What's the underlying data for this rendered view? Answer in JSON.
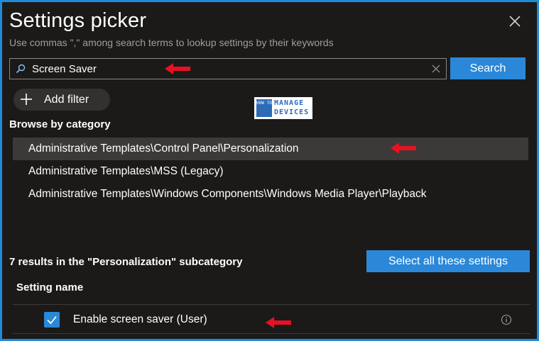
{
  "dialog": {
    "title": "Settings picker",
    "subtitle": "Use commas \",\" among search terms to lookup settings by their keywords"
  },
  "search": {
    "value": "Screen Saver",
    "button_label": "Search"
  },
  "add_filter": {
    "label": "Add filter"
  },
  "watermark": {
    "line1": "MANAGE",
    "line2": "DEVICES",
    "small": "HOW TO"
  },
  "browse": {
    "heading": "Browse by category",
    "categories": [
      {
        "label": "Administrative Templates\\Control Panel\\Personalization",
        "selected": true
      },
      {
        "label": "Administrative Templates\\MSS (Legacy)",
        "selected": false
      },
      {
        "label": "Administrative Templates\\Windows Components\\Windows Media Player\\Playback",
        "selected": false
      }
    ]
  },
  "results": {
    "summary": "7 results in the \"Personalization\" subcategory",
    "select_all_label": "Select all these settings",
    "column_header": "Setting name",
    "rows": [
      {
        "label": "Enable screen saver (User)",
        "checked": true
      }
    ]
  },
  "colors": {
    "accent": "#2b88d8",
    "background": "#1b1a19",
    "frame_border": "#1f8bd6",
    "annotation_arrow": "#e81123"
  }
}
